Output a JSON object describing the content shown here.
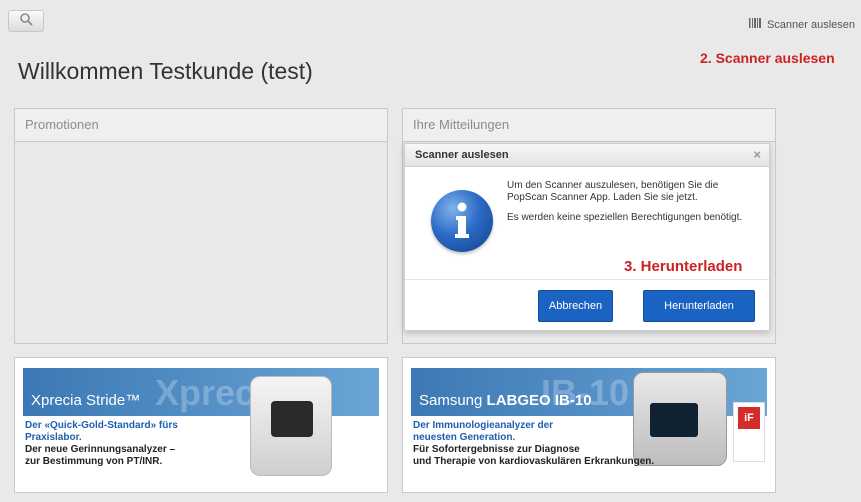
{
  "header": {
    "scanner_link": "Scanner auslesen",
    "welcome": "Willkommen Testkunde (test)"
  },
  "annotations": {
    "step2": "2. Scanner auslesen",
    "step3": "3. Herunterladen"
  },
  "panels": {
    "promotions_title": "Promotionen",
    "messages_title": "Ihre Mitteilungen"
  },
  "dialog": {
    "title": "Scanner auslesen",
    "close": "×",
    "text1": "Um den Scanner auszulesen, benötigen Sie die PopScan Scanner App. Laden Sie sie jetzt.",
    "text2": "Es werden keine speziellen Berechtigungen benötigt.",
    "cancel": "Abbrechen",
    "download": "Herunterladen"
  },
  "ads": {
    "left": {
      "watermark": "Xprec",
      "title": "Xprecia Stride™",
      "line1": "Der «Quick-Gold-Standard» fürs",
      "line2": "Praxislabor.",
      "line3": "Der neue Gerinnungsanalyzer –",
      "line4": "zur Bestimmung von PT/INR."
    },
    "right": {
      "watermark": "IB-10",
      "title_prefix": "Samsung ",
      "title_bold": "LABGEO IB-10",
      "line1": "Der Immunologieanalyzer der",
      "line2": "neuesten Generation.",
      "line3": "Für Sofortergebnisse zur Diagnose",
      "line4": "und Therapie von kardiovaskulären Erkrankungen.",
      "badge": "iF"
    }
  },
  "colors": {
    "accent": "#1a63c2",
    "annotation": "#cc2222",
    "background": "#e9e9e9"
  },
  "icons": {
    "search": "search-icon",
    "barcode": "barcode-icon",
    "info": "info-icon",
    "close": "close-icon"
  }
}
